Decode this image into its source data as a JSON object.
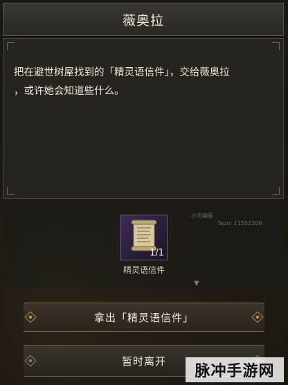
{
  "title": "薇奥拉",
  "dialog": {
    "line1": "把在避世树屋找到的「精灵语信件」，交给薇奥拉",
    "line2": "，或许她会知道些什么。"
  },
  "item": {
    "name": "精灵语信件",
    "count": "1/1",
    "icon": "scroll-letter-icon"
  },
  "background_text": {
    "player_name": "小天幽是",
    "tapo": "Tapo: 11552209"
  },
  "buttons": {
    "give_label": "拿出「精灵语信件」",
    "leave_label": "暂时离开"
  },
  "watermark": "脉冲手游网",
  "colors": {
    "panel": "#2b2824",
    "accent": "#b5895a",
    "item_bg": "#3c2a55"
  }
}
